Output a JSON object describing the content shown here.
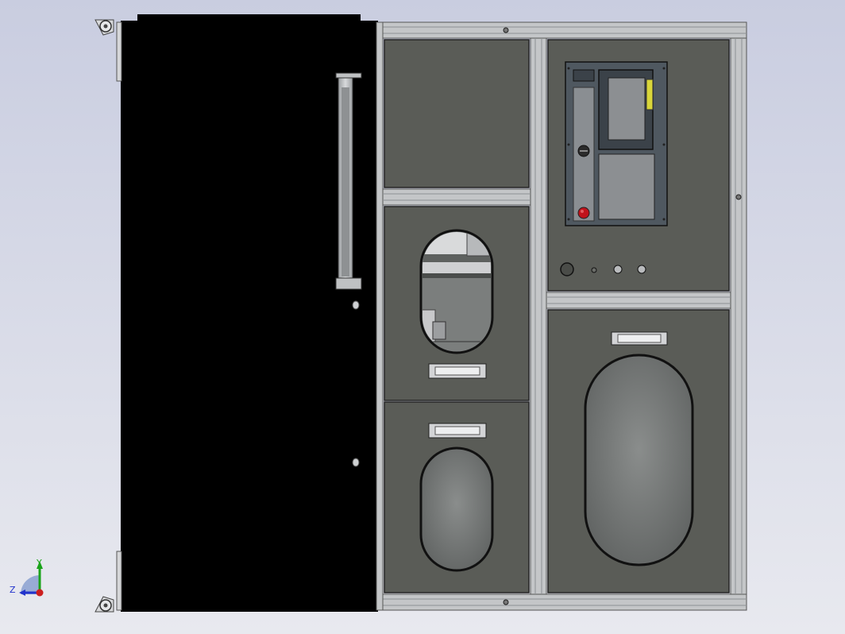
{
  "viewport": {
    "background_top": "#c9cde0",
    "background_bottom": "#e8e9ef"
  },
  "colors": {
    "frame_metal": "#c4c6c8",
    "frame_shadow": "#8d9093",
    "panel_fill": "#5a5c57",
    "left_body": "#000000",
    "window_glass": "#7a7d7c",
    "control_panel": "#4f5860",
    "estop_red": "#c0131b",
    "label_yellow": "#d9d63a"
  },
  "orientation_triad": {
    "y_label": "Y",
    "z_label": "Z",
    "y_color": "#19a319",
    "z_color": "#2233cc",
    "x_color": "#cc1f1f"
  },
  "icons": {
    "caster": "caster-wheel-icon",
    "handle": "door-handle-icon",
    "estop": "emergency-stop-icon"
  }
}
